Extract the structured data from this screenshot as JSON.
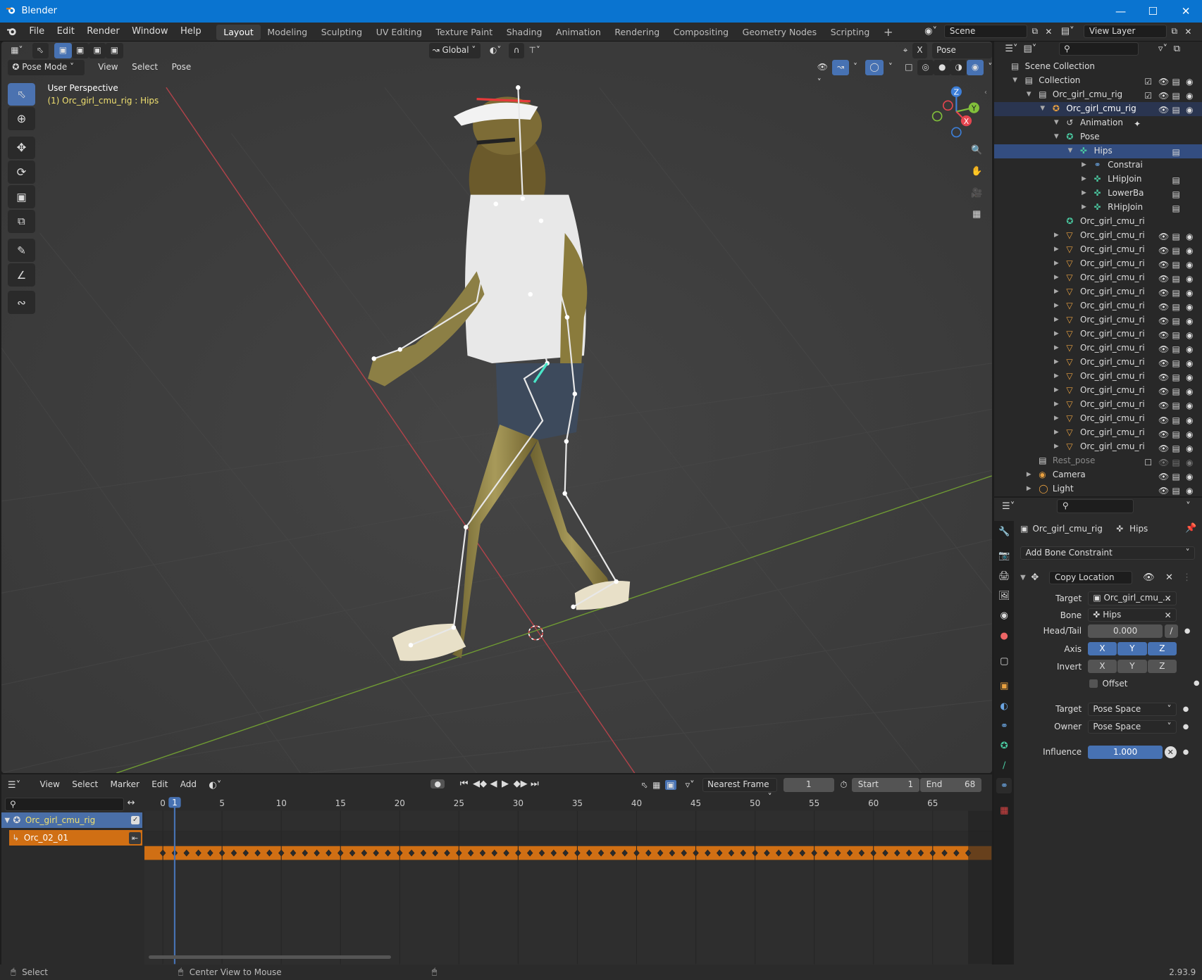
{
  "window": {
    "title": "Blender"
  },
  "menu": [
    "File",
    "Edit",
    "Render",
    "Window",
    "Help"
  ],
  "workspaces": [
    "Layout",
    "Modeling",
    "Sculpting",
    "UV Editing",
    "Texture Paint",
    "Shading",
    "Animation",
    "Rendering",
    "Compositing",
    "Geometry Nodes",
    "Scripting"
  ],
  "add_workspace": "+",
  "scene": "Scene",
  "view_layer": "View Layer",
  "viewport": {
    "mode": "Pose Mode",
    "menus": [
      "View",
      "Select",
      "Pose"
    ],
    "orientation": "Global",
    "pose_options": "Pose Options",
    "overlay_title": "User Perspective",
    "overlay_sub": "(1) Orc_girl_cmu_rig : Hips",
    "gizmo": {
      "x": "X",
      "y": "Y",
      "z": "Z"
    }
  },
  "outliner": {
    "rows": [
      {
        "label": "Scene Collection",
        "depth": 0,
        "icon": "scene-collection-icon",
        "vis": false
      },
      {
        "label": "Collection",
        "depth": 1,
        "icon": "collection-icon",
        "vis": true,
        "check": true
      },
      {
        "label": "Orc_girl_cmu_rig",
        "depth": 2,
        "icon": "collection-icon",
        "vis": true,
        "check": true
      },
      {
        "label": "Orc_girl_cmu_rig",
        "depth": 3,
        "icon": "armature-icon",
        "vis": true,
        "hl": true
      },
      {
        "label": "Animation",
        "depth": 4,
        "icon": "animation-icon",
        "vis": false
      },
      {
        "label": "Pose",
        "depth": 4,
        "icon": "pose-icon",
        "vis": false
      },
      {
        "label": "Hips",
        "depth": 5,
        "icon": "bone-icon",
        "vis": false,
        "selected": true,
        "mon": true
      },
      {
        "label": "Constrai",
        "depth": 6,
        "icon": "constraint-icon",
        "vis": false
      },
      {
        "label": "LHipJoin",
        "depth": 6,
        "icon": "bone-icon",
        "vis": false,
        "mon": true
      },
      {
        "label": "LowerBa",
        "depth": 6,
        "icon": "bone-icon",
        "vis": false,
        "mon": true
      },
      {
        "label": "RHipJoin",
        "depth": 6,
        "icon": "bone-icon",
        "vis": false,
        "mon": true
      },
      {
        "label": "Orc_girl_cmu_ri",
        "depth": 4,
        "icon": "armature-data-icon",
        "vis": false,
        "notri": true
      },
      {
        "label": "Orc_girl_cmu_ri",
        "depth": 4,
        "icon": "mesh-icon",
        "vis": true
      },
      {
        "label": "Orc_girl_cmu_ri",
        "depth": 4,
        "icon": "mesh-icon",
        "vis": true
      },
      {
        "label": "Orc_girl_cmu_ri",
        "depth": 4,
        "icon": "mesh-icon",
        "vis": true
      },
      {
        "label": "Orc_girl_cmu_ri",
        "depth": 4,
        "icon": "mesh-icon",
        "vis": true
      },
      {
        "label": "Orc_girl_cmu_ri",
        "depth": 4,
        "icon": "mesh-icon",
        "vis": true
      },
      {
        "label": "Orc_girl_cmu_ri",
        "depth": 4,
        "icon": "mesh-icon",
        "vis": true
      },
      {
        "label": "Orc_girl_cmu_ri",
        "depth": 4,
        "icon": "mesh-icon",
        "vis": true
      },
      {
        "label": "Orc_girl_cmu_ri",
        "depth": 4,
        "icon": "mesh-icon",
        "vis": true
      },
      {
        "label": "Orc_girl_cmu_ri",
        "depth": 4,
        "icon": "mesh-icon",
        "vis": true
      },
      {
        "label": "Orc_girl_cmu_ri",
        "depth": 4,
        "icon": "mesh-icon",
        "vis": true
      },
      {
        "label": "Orc_girl_cmu_ri",
        "depth": 4,
        "icon": "mesh-icon",
        "vis": true
      },
      {
        "label": "Orc_girl_cmu_ri",
        "depth": 4,
        "icon": "mesh-icon",
        "vis": true
      },
      {
        "label": "Orc_girl_cmu_ri",
        "depth": 4,
        "icon": "mesh-icon",
        "vis": true
      },
      {
        "label": "Orc_girl_cmu_ri",
        "depth": 4,
        "icon": "mesh-icon",
        "vis": true
      },
      {
        "label": "Orc_girl_cmu_ri",
        "depth": 4,
        "icon": "mesh-icon",
        "vis": true
      },
      {
        "label": "Orc_girl_cmu_ri",
        "depth": 4,
        "icon": "mesh-icon",
        "vis": true
      },
      {
        "label": "Rest_pose",
        "depth": 2,
        "icon": "collection-icon",
        "vis": true,
        "dim": true,
        "check": false,
        "notri": true
      },
      {
        "label": "Camera",
        "depth": 2,
        "icon": "camera-icon",
        "vis": true
      },
      {
        "label": "Light",
        "depth": 2,
        "icon": "light-icon",
        "vis": true
      }
    ]
  },
  "properties": {
    "object": "Orc_girl_cmu_rig",
    "bone": "Hips",
    "add_constraint": "Add Bone Constraint",
    "constraint_name": "Copy Location",
    "target_label": "Target",
    "target_value": "Orc_girl_cmu_...",
    "bone_label": "Bone",
    "bone_value": "Hips",
    "headtail_label": "Head/Tail",
    "headtail_value": "0.000",
    "axis_label": "Axis",
    "invert_label": "Invert",
    "x": "X",
    "y": "Y",
    "z": "Z",
    "offset_label": "Offset",
    "target_space_label": "Target",
    "target_space": "Pose Space",
    "owner_space_label": "Owner",
    "owner_space": "Pose Space",
    "influence_label": "Influence",
    "influence_value": "1.000"
  },
  "timeline": {
    "menus": [
      "View",
      "Select",
      "Marker",
      "Edit",
      "Add"
    ],
    "snap": "Nearest Frame",
    "current_frame": "1",
    "start_label": "Start",
    "start": "1",
    "end_label": "End",
    "end": "68",
    "ticks": [
      "0",
      "5",
      "10",
      "15",
      "20",
      "25",
      "30",
      "35",
      "40",
      "45",
      "50",
      "55",
      "60",
      "65"
    ],
    "current_marker": "1",
    "channels": [
      {
        "name": "Orc_girl_cmu_rig"
      },
      {
        "name": "Orc_02_01"
      }
    ]
  },
  "status": {
    "left": "Select",
    "middle": "Center View to Mouse",
    "version": "2.93.9"
  },
  "colors": {
    "accent": "#4772b3",
    "orange": "#d06f14",
    "x_axis": "#e5454f",
    "y_axis": "#82c03b",
    "z_axis": "#3d7fd8"
  }
}
